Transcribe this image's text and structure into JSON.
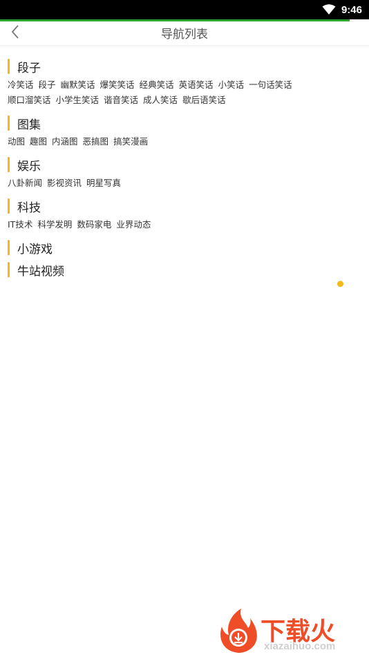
{
  "status_bar": {
    "time": "9:46"
  },
  "header": {
    "title": "导航列表"
  },
  "colors": {
    "accent": "#f5b819",
    "progress": "#2ea52e",
    "watermark": "#ef4d27",
    "dot": "#f5b819"
  },
  "sections": [
    {
      "title": "段子",
      "items": [
        "冷笑话",
        "段子",
        "幽默笑话",
        "爆笑笑话",
        "经典笑话",
        "英语笑话",
        "小笑话",
        "一句话笑话",
        "顺口溜笑话",
        "小学生笑话",
        "谐音笑话",
        "成人笑话",
        "歇后语笑话"
      ]
    },
    {
      "title": "图集",
      "items": [
        "动图",
        "趣图",
        "内涵图",
        "恶搞图",
        "搞笑漫画"
      ]
    },
    {
      "title": "娱乐",
      "items": [
        "八卦新闻",
        "影视资讯",
        "明星写真"
      ]
    },
    {
      "title": "科技",
      "items": [
        "IT技术",
        "科学发明",
        "数码家电",
        "业界动态"
      ]
    },
    {
      "title": "小游戏",
      "items": []
    },
    {
      "title": "牛站视频",
      "items": []
    }
  ],
  "watermark": {
    "text": "下载火",
    "url": "xiazaihuo.com"
  }
}
